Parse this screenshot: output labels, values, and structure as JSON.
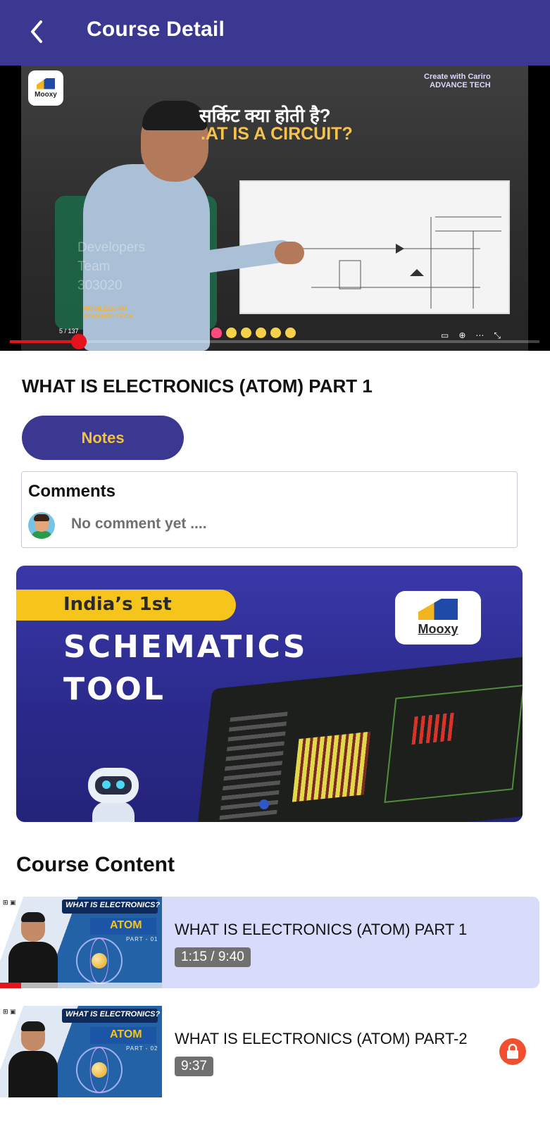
{
  "header": {
    "title": "Course Detail",
    "back_icon": "chevron-left-icon",
    "background_color": "#3a3891"
  },
  "player": {
    "hindi_text": "सर्किट क्या होती है?",
    "circuit_text": ".AT IS A CIRCUIT?",
    "badge_text": "Mooxy",
    "brand_top_line1": "Create with Cariro",
    "brand_top_line2": "ADVANCE TECH",
    "watermark_line1": "Developers",
    "watermark_line2": "Team",
    "watermark_line3": "303020",
    "brand_bottom_line1": "MOBILEGURU",
    "brand_bottom_line2": "ADVANCE TECH",
    "page_counter": "5 / 137",
    "progress_fraction": 0.13,
    "progress_color": "#e3141b"
  },
  "lesson": {
    "title": "WHAT IS ELECTRONICS (ATOM) PART 1",
    "notes_label": "Notes"
  },
  "comments": {
    "title": "Comments",
    "placeholder": "No comment yet ....",
    "avatar_icon": "avatar-icon"
  },
  "banner": {
    "pill_text": "India’s 1st",
    "title_line1": "SCHEMATICS",
    "title_line2": "TOOL",
    "logo_text": "Mooxy"
  },
  "course_content": {
    "title": "Course Content",
    "items": [
      {
        "thumb_heading": "WHAT IS ELECTRONICS?",
        "thumb_atom": "ATOM",
        "thumb_part": "PART - 01",
        "title": "WHAT IS ELECTRONICS (ATOM) PART 1",
        "duration": "1:15 / 9:40",
        "watched_fraction": 0.13,
        "active": true,
        "locked": false
      },
      {
        "thumb_heading": "WHAT IS ELECTRONICS?",
        "thumb_atom": "ATOM",
        "thumb_part": "PART - 02",
        "title": "WHAT IS ELECTRONICS (ATOM) PART-2",
        "duration": "9:37",
        "active": false,
        "locked": true,
        "lock_icon": "lock-icon"
      }
    ]
  }
}
